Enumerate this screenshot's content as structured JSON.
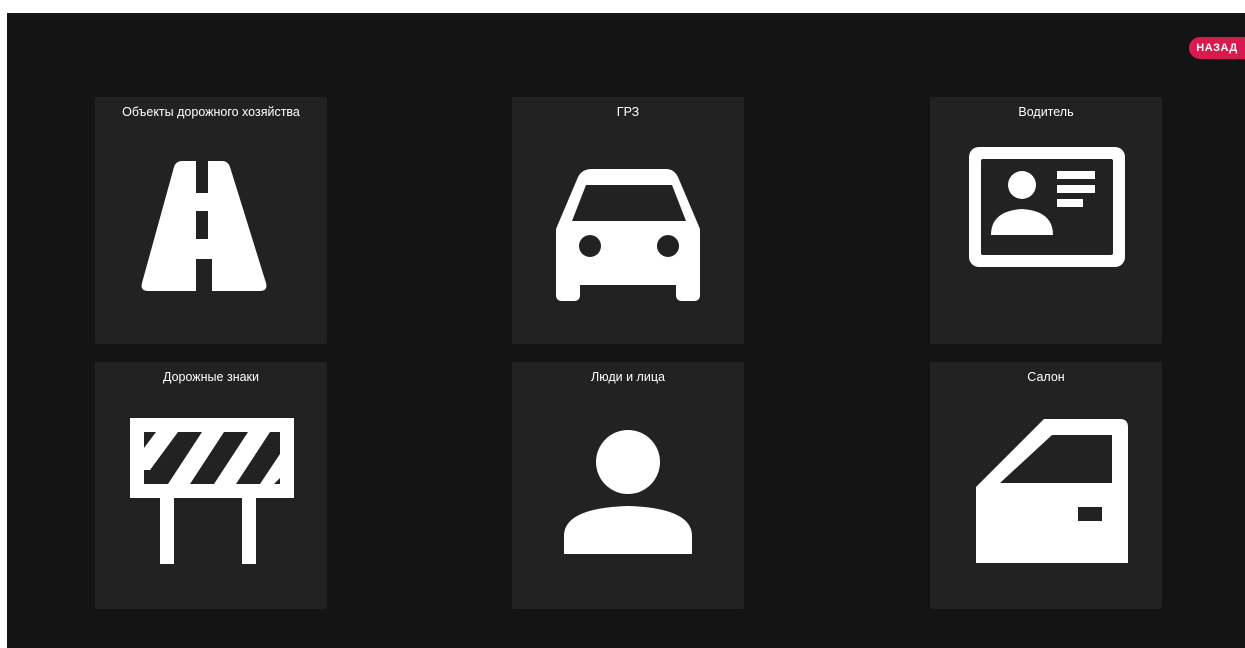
{
  "back_button": {
    "label": "НАЗАД"
  },
  "tiles": [
    {
      "label": "Объекты дорожного хозяйства",
      "icon": "road-icon"
    },
    {
      "label": "ГРЗ",
      "icon": "car-icon"
    },
    {
      "label": "Водитель",
      "icon": "driver-license-icon"
    },
    {
      "label": "Дорожные знаки",
      "icon": "road-barrier-icon"
    },
    {
      "label": "Люди и лица",
      "icon": "person-icon"
    },
    {
      "label": "Салон",
      "icon": "car-door-icon"
    }
  ],
  "colors": {
    "background": "#141414",
    "tile": "#222222",
    "accent": "#d81b4f",
    "icon": "#ffffff"
  }
}
